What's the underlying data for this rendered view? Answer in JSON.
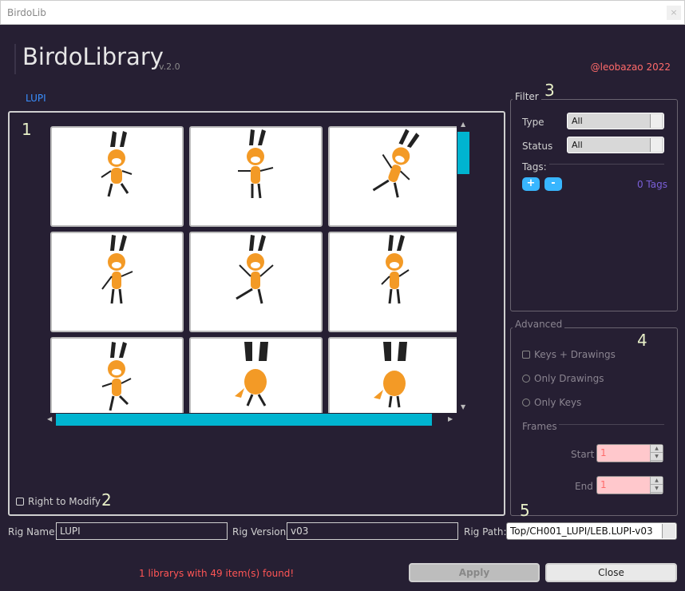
{
  "window": {
    "title": "BirdoLib",
    "close_glyph": "×"
  },
  "header": {
    "app_title": "BirdoLibrary",
    "version": "v.2.0",
    "copyright": "@leobazao 2022"
  },
  "library": {
    "tab_label": "LUPI",
    "modify_checkbox_label": "Right to Modify",
    "modify_checked": false
  },
  "badges": {
    "b1": "1",
    "b2": "2",
    "b3": "3",
    "b4": "4",
    "b5": "5"
  },
  "filter": {
    "label": "Filter",
    "type_label": "Type",
    "type_value": "All",
    "status_label": "Status",
    "status_value": "All",
    "tags_label": "Tags:",
    "add_tag": "+",
    "remove_tag": "-",
    "tags_count": "0 Tags"
  },
  "advanced": {
    "label": "Advanced",
    "options": [
      "Keys + Drawings",
      "Only Drawings",
      "Only Keys"
    ],
    "frames_label": "Frames",
    "start_label": "Start",
    "start_value": "1",
    "end_label": "End",
    "end_value": "1"
  },
  "rig": {
    "name_label": "Rig Name:",
    "name_value": "LUPI",
    "version_label": "Rig Version:",
    "version_value": "v03",
    "path_label": "Rig Path:",
    "path_value": "Top/CH001_LUPI/LEB.LUPI-v03"
  },
  "status_text": "1 librarys with 49 item(s) found!",
  "buttons": {
    "apply": "Apply",
    "close": "Close"
  },
  "colors": {
    "accent": "#00b4d0",
    "background": "#261f33",
    "warning": "#ff5555"
  }
}
